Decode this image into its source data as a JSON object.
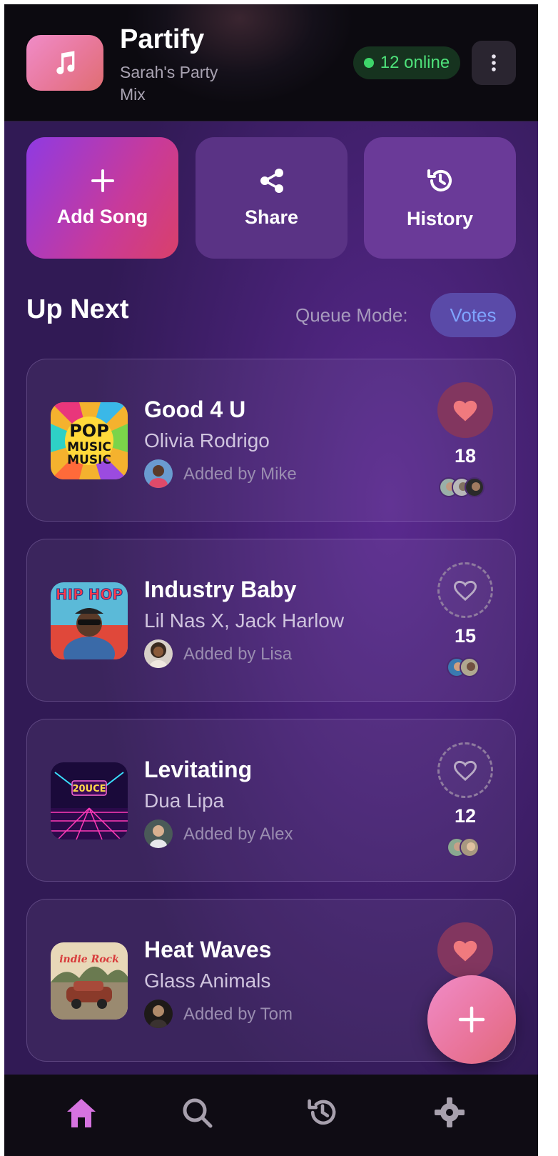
{
  "header": {
    "app_title": "Partify",
    "party_name": "Sarah's Party Mix",
    "online_count": "12 online",
    "music_icon": "music-note-icon",
    "menu_icon": "more-vertical-icon"
  },
  "actions": [
    {
      "label": "Add Song",
      "icon": "plus-icon"
    },
    {
      "label": "Share",
      "icon": "share-icon"
    },
    {
      "label": "History",
      "icon": "history-icon"
    }
  ],
  "queue": {
    "heading": "Up Next",
    "mode_label": "Queue Mode:",
    "mode_value": "Votes",
    "songs": [
      {
        "title": "Good 4 U",
        "artist": "Olivia Rodrigo",
        "added_by": "Added by Mike",
        "votes": "18",
        "liked": true,
        "cover_text": [
          "POP",
          "MUSIC",
          "MUSIC"
        ]
      },
      {
        "title": "Industry Baby",
        "artist": "Lil Nas X, Jack Harlow",
        "added_by": "Added by Lisa",
        "votes": "15",
        "liked": false,
        "cover_text": [
          "HIP HOP"
        ]
      },
      {
        "title": "Levitating",
        "artist": "Dua Lipa",
        "added_by": "Added by Alex",
        "votes": "12",
        "liked": false,
        "cover_text": [
          "20UCE"
        ]
      },
      {
        "title": "Heat Waves",
        "artist": "Glass Animals",
        "added_by": "Added by Tom",
        "votes": "",
        "liked": true,
        "cover_text": [
          "indie Rock"
        ]
      }
    ]
  },
  "fab": {
    "icon": "plus-icon"
  },
  "nav": [
    {
      "name": "home",
      "icon": "home-icon",
      "active": true
    },
    {
      "name": "search",
      "icon": "search-icon",
      "active": false
    },
    {
      "name": "history",
      "icon": "history-icon",
      "active": false
    },
    {
      "name": "settings",
      "icon": "gear-icon",
      "active": false
    }
  ],
  "colors": {
    "accent_pink": "#e8789a",
    "online_green": "#4ee27a",
    "votes_blue": "#7fa4ff",
    "nav_active": "#d673e0"
  }
}
